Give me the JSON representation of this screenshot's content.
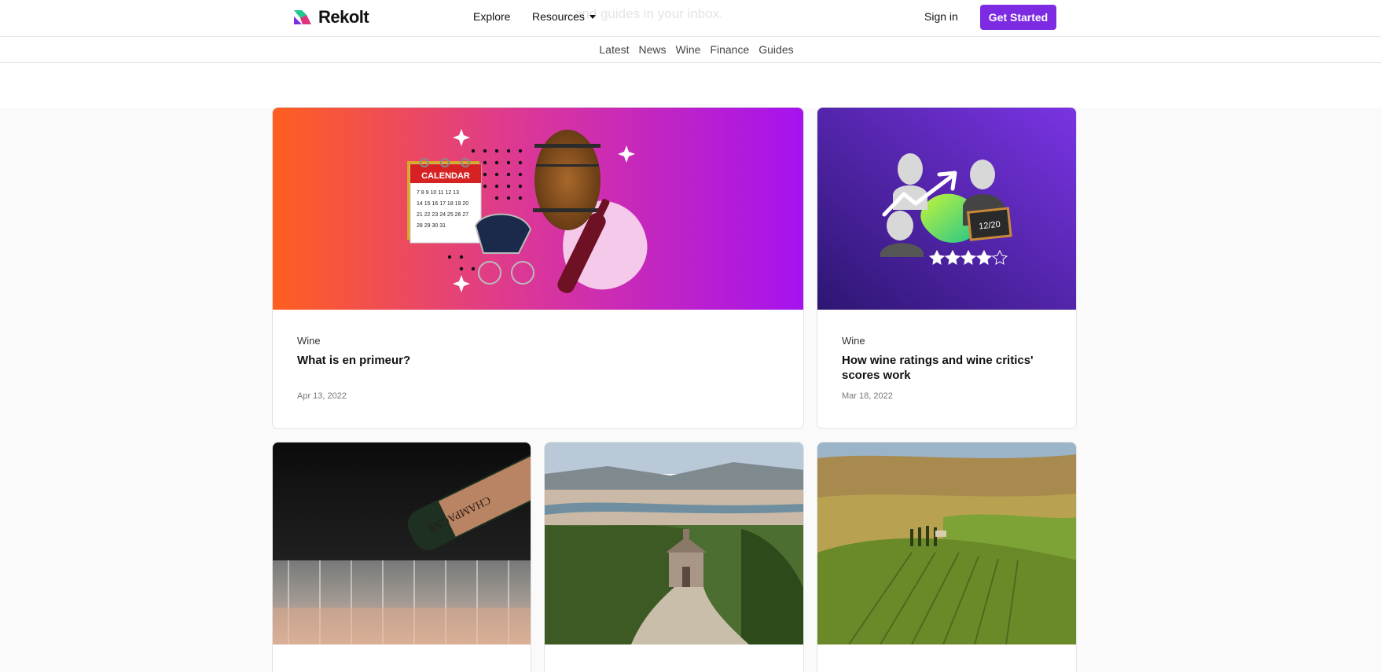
{
  "header": {
    "background_text": "... and guides in your inbox.",
    "logo_text": "Rekolt",
    "nav": {
      "explore": "Explore",
      "resources": "Resources"
    },
    "sign_in": "Sign in",
    "cta": "Get Started"
  },
  "categories_nav": [
    "Latest",
    "News",
    "Wine",
    "Finance",
    "Guides"
  ],
  "articles": [
    {
      "category": "Wine",
      "title": "What is en primeur?",
      "date": "Apr 13, 2022",
      "image": "en-primeur-collage"
    },
    {
      "category": "Wine",
      "title": "How wine ratings and wine critics' scores work",
      "date": "Mar 18, 2022",
      "image": "wine-critics-collage",
      "score_text": "12/20"
    },
    {
      "image": "champagne-pour-photo"
    },
    {
      "image": "chapel-vineyard-photo"
    },
    {
      "image": "rolling-vineyards-photo"
    }
  ],
  "colors": {
    "brand": "#7c2be3",
    "gradient_start": "#ff5f1f",
    "gradient_mid": "#d9359d",
    "gradient_end": "#a512f0",
    "purple_dark": "#3a1e8c",
    "purple_light": "#7a34e3"
  }
}
